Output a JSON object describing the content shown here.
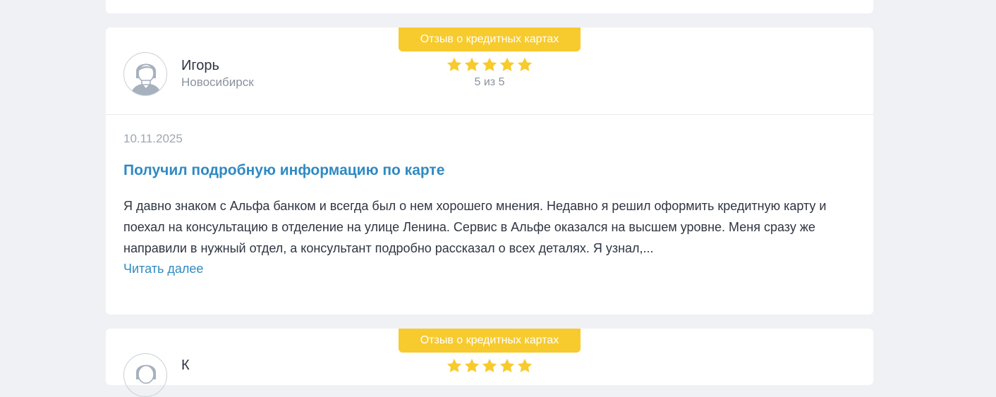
{
  "reviews": [
    {
      "category_badge": "Отзыв о кредитных картах",
      "author": {
        "name": "Игорь",
        "city": "Новосибирск",
        "avatar_icon": "user-avatar-icon"
      },
      "rating": {
        "value": 5,
        "max": 5,
        "text": "5 из 5",
        "star_color": "#f7ca2d"
      },
      "date": "10.11.2025",
      "title": "Получил подробную информацию по карте",
      "text": "Я давно знаком с Альфа банком и всегда был о нем хорошего мнения. Недавно я решил оформить кредитную карту и поехал на консультацию в отделение на улице Ленина. Сервис в Альфе оказался на высшем уровне. Меня сразу же направили в нужный отдел, а консультант подробно рассказал о всех деталях. Я узнал,...",
      "read_more_label": "Читать далее"
    },
    {
      "category_badge": "Отзыв о кредитных картах",
      "author": {
        "name": "К",
        "avatar_icon": "user-avatar-icon"
      },
      "rating": {
        "star_color": "#f7ca2d"
      }
    }
  ],
  "colors": {
    "page_background": "#eff1f4",
    "card_background": "#ffffff",
    "badge_background": "#f7ca2d",
    "link": "#2f8ac3",
    "text": "#2f3541",
    "muted": "#8a929d"
  }
}
